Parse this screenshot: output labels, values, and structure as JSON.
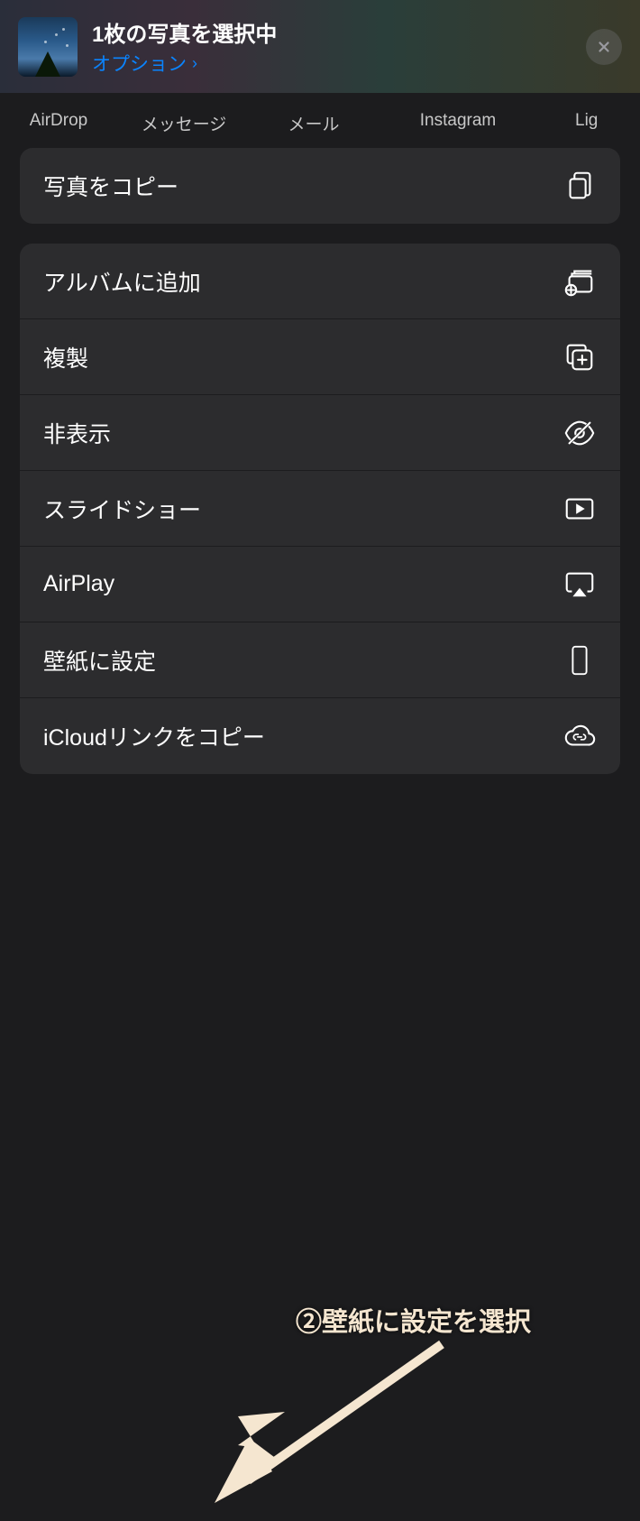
{
  "header": {
    "title": "1枚の写真を選択中",
    "options_label": "オプション",
    "options_chevron": "›"
  },
  "apps": [
    "AirDrop",
    "メッセージ",
    "メール",
    "Instagram",
    "Lig"
  ],
  "groups": [
    {
      "items": [
        {
          "name": "copy-photo",
          "label": "写真をコピー",
          "icon": "copy-icon"
        }
      ]
    },
    {
      "items": [
        {
          "name": "add-to-album",
          "label": "アルバムに追加",
          "icon": "album-add-icon"
        },
        {
          "name": "duplicate",
          "label": "複製",
          "icon": "duplicate-icon"
        },
        {
          "name": "hide",
          "label": "非表示",
          "icon": "eye-slash-icon"
        },
        {
          "name": "slideshow",
          "label": "スライドショー",
          "icon": "play-rect-icon"
        },
        {
          "name": "airplay",
          "label": "AirPlay",
          "icon": "airplay-icon"
        },
        {
          "name": "set-wallpaper",
          "label": "壁紙に設定",
          "icon": "phone-icon"
        },
        {
          "name": "icloud-link",
          "label": "iCloudリンクをコピー",
          "icon": "cloud-link-icon"
        }
      ]
    }
  ],
  "annotation": {
    "text": "②壁紙に設定を選択"
  }
}
